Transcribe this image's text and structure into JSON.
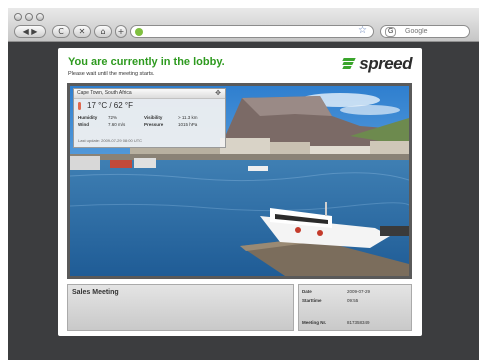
{
  "browser": {
    "search_placeholder": "Google",
    "nav_back": "◀",
    "nav_forward": "▶",
    "nav_reload": "C",
    "nav_stop": "✕",
    "nav_home": "⌂",
    "add": "+",
    "bookmark_star": "☆",
    "search_engine": "G"
  },
  "lobby": {
    "title": "You are currently in the lobby.",
    "subtitle": "Please wait until the meeting starts.",
    "logo_text": "spreed"
  },
  "weather": {
    "location": "Cape Town, South Africa",
    "move_glyph": "✥",
    "temperature": "17 °C / 62 °F",
    "humidity_label": "Humidity",
    "humidity_value": "72%",
    "visibility_label": "Visibility",
    "visibility_value": "> 11.3 km",
    "wind_label": "Wind",
    "wind_value": "7.60 m/s",
    "pressure_label": "Pressure",
    "pressure_value": "1015 hPa",
    "last_update": "Last update: 2009-07-29 08:00 UTC"
  },
  "meeting": {
    "name": "Sales Meeting",
    "date_label": "Date",
    "date_value": "2009-07-29",
    "start_label": "Starttime",
    "start_value": "09:55",
    "number_label": "Meeting Nr.",
    "number_value": "817358349"
  },
  "colors": {
    "title_green": "#2e9a1f",
    "page_bg": "#3c3d3f",
    "sky": "#4a9fd8",
    "water": "#2f6fa8"
  }
}
